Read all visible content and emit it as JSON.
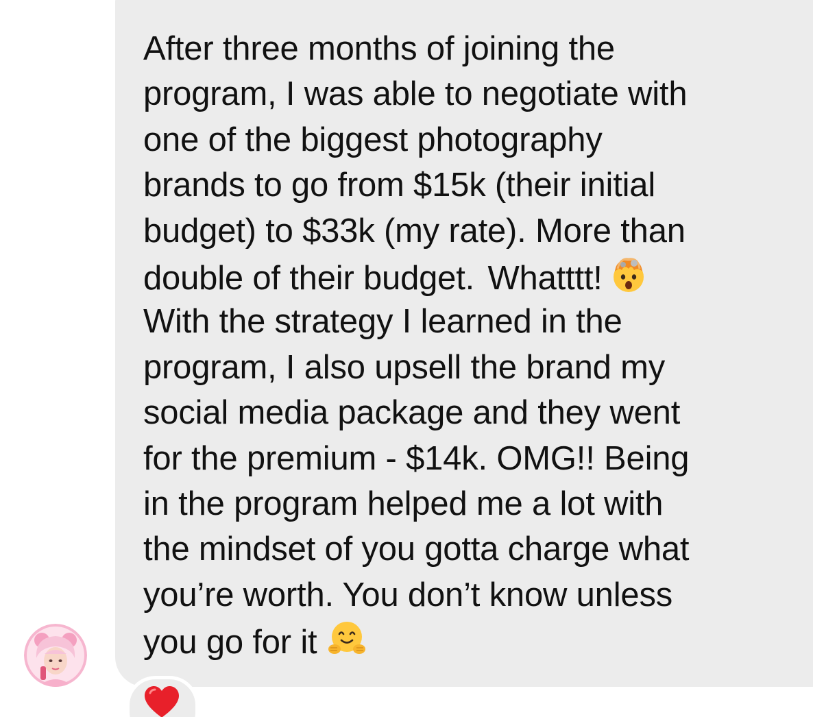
{
  "message": {
    "lines": [
      {
        "pre": "After three months of joining the",
        "hl": "",
        "post": ""
      },
      {
        "pre": "program, ",
        "hl": "I was able to negotiate with",
        "post": ""
      },
      {
        "pre": "",
        "hl": "one of the biggest photography",
        "post": ""
      },
      {
        "pre": "",
        "hl": "brands to go from $15k (their initial",
        "post": ""
      },
      {
        "pre": "",
        "hl": "budget) to $33k (my rate). More than",
        "post": ""
      },
      {
        "pre": "",
        "hl": "double of their budget.",
        "post": " Whatttt!"
      },
      {
        "pre": "With the strategy I learned in the",
        "hl": "",
        "post": ""
      },
      {
        "pre": "program, I also upsell the brand my",
        "hl": "",
        "post": ""
      },
      {
        "pre": "social media package and they went",
        "hl": "",
        "post": ""
      },
      {
        "pre": "for the premium - $14k. OMG!! Being",
        "hl": "",
        "post": ""
      },
      {
        "pre": "in the program helped me a lot with",
        "hl": "",
        "post": ""
      },
      {
        "pre": "the mindset of you gotta charge what",
        "hl": "",
        "post": ""
      },
      {
        "pre": "you’re worth. You don’t know unless",
        "hl": "",
        "post": ""
      },
      {
        "pre": "you go for it",
        "hl": "",
        "post": ""
      }
    ],
    "emoji_exploding_head": "exploding-head-emoji",
    "emoji_hugging": "hugging-face-emoji"
  },
  "highlight_color": "#f5e564",
  "bubble_color": "#ececec",
  "text_color": "#111111",
  "reaction": {
    "icon": "red-heart-emoji",
    "color": "#e8202a"
  },
  "avatar": {
    "icon": "user-avatar",
    "accent": "#f6b6cf"
  }
}
